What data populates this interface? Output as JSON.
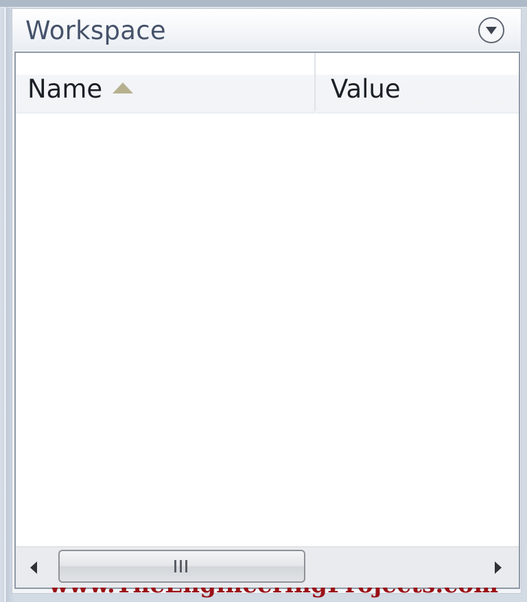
{
  "panel": {
    "title": "Workspace",
    "menu_icon": "chevron-down-circle-icon"
  },
  "table": {
    "columns": [
      {
        "label": "Name",
        "sort": "ascending"
      },
      {
        "label": "Value"
      }
    ],
    "rows": []
  },
  "watermark": "www.TheEngineeringProjects.com",
  "scrollbar": {
    "left_icon": "arrow-left-icon",
    "right_icon": "arrow-right-icon",
    "thumb_grip_icon": "grip-lines-icon"
  },
  "colors": {
    "title_text": "#45526a",
    "watermark": "#9a1218",
    "sort_arrow": "#b6b08f"
  }
}
